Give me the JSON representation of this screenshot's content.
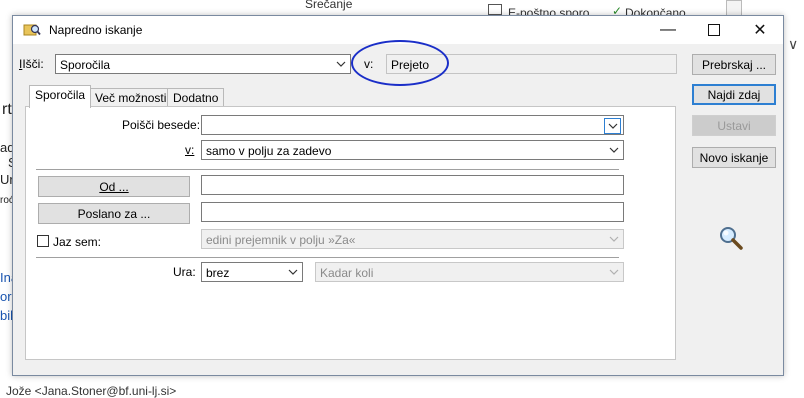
{
  "background": {
    "snippets": [
      "Srečanje",
      "E-poštno sporo",
      "Dokončano",
      "rtk",
      "ad",
      "S",
      "Ura",
      "roć",
      "Ina",
      "oro",
      "bil",
      "Jože <Jana.Stoner@bf.uni-lj.si>"
    ]
  },
  "dialog": {
    "title": "Napredno iskanje",
    "search_label": "Išči:",
    "search_value": "Sporočila",
    "in_label": "v:",
    "in_value": "Prejeto",
    "buttons": {
      "browse": "Prebrskaj ...",
      "find_now": "Najdi zdaj",
      "stop": "Ustavi",
      "new_search": "Novo iskanje"
    },
    "tabs": [
      "Sporočila",
      "Več možnosti",
      "Dodatno"
    ],
    "fields": {
      "search_words_label": "Poišči besede:",
      "search_words_value": "",
      "in_label": "v:",
      "in_value": "samo v polju za zadevo",
      "from_button": "Od ...",
      "from_value": "",
      "sent_to_button": "Poslano za ...",
      "sent_to_value": "",
      "me_label": "Jaz sem:",
      "me_checked": false,
      "me_value": "edini prejemnik v polju »Za«",
      "time_label": "Ura:",
      "time_value": "brez",
      "time_range_value": "Kadar koli"
    }
  },
  "icons": {
    "app": "search-folder-icon",
    "magnifier": "magnifier-icon"
  },
  "colors": {
    "annotation_circle": "#1a2ec8",
    "focus_blue": "#2d7fd2"
  }
}
